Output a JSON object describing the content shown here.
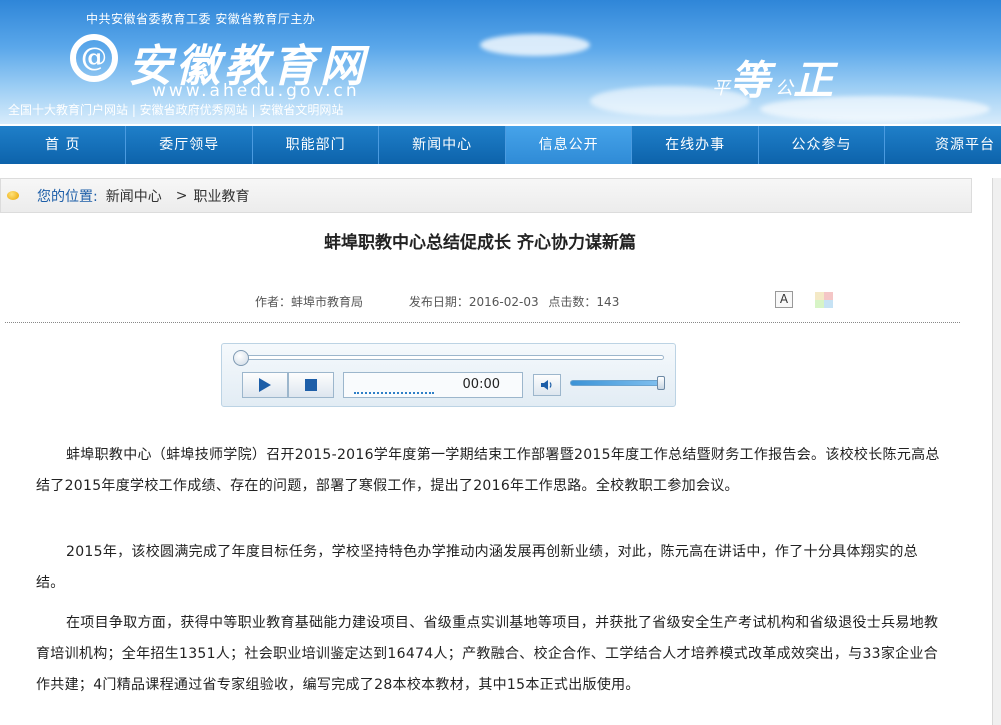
{
  "header": {
    "org_line": "中共安徽省委教育工委  安徽省教育厅主办",
    "logo_mark": "@",
    "logo_text": "安徽教育网",
    "logo_url": "www.ahedu.gov.cn",
    "portal_line": "全国十大教育门户网站  |  安徽省政府优秀网站  |  安徽省文明网站",
    "slogan_small_1": "平",
    "slogan_large_1": "等",
    "slogan_small_2": "公",
    "slogan_large_2": "正"
  },
  "nav": {
    "items": [
      "首  页",
      "委厅领导",
      "职能部门",
      "新闻中心",
      "信息公开",
      "在线办事",
      "公众参与",
      "资源平台"
    ],
    "active_index": 4
  },
  "breadcrumb": {
    "label": "您的位置:",
    "items": [
      "新闻中心",
      "职业教育"
    ],
    "separator": ">"
  },
  "article": {
    "title": "蚌埠职教中心总结促成长 齐心协力谋新篇",
    "author": "作者：蚌埠市教育局",
    "date": "发布日期：2016-02-03",
    "clicks": "点击数：143",
    "font_button": "A",
    "paragraphs": [
      "蚌埠职教中心（蚌埠技师学院）召开2015-2016学年度第一学期结束工作部署暨2015年度工作总结暨财务工作报告会。该校校长陈元高总结了2015年度学校工作成绩、存在的问题，部署了寒假工作，提出了2016年工作思路。全校教职工参加会议。",
      "2015年，该校圆满完成了年度目标任务，学校坚持特色办学推动内涵发展再创新业绩，对此，陈元高在讲话中，作了十分具体翔实的总结。",
      "在项目争取方面，获得中等职业教育基础能力建设项目、省级重点实训基地等项目，并获批了省级安全生产考试机构和省级退役士兵易地教育培训机构；全年招生1351人；社会职业培训鉴定达到16474人；产教融合、校企合作、工学结合人才培养模式改革成效突出，与33家企业合作共建；4门精品课程通过省专家组验收，编写完成了28本校本教材，其中15本正式出版使用。"
    ]
  },
  "player": {
    "time": "00:00",
    "progress": 0,
    "volume": 1
  },
  "colors": {
    "nav_bg": "#0d63ab",
    "nav_active": "#2f8bd6",
    "breadcrumb_label": "#1d5ea8"
  }
}
